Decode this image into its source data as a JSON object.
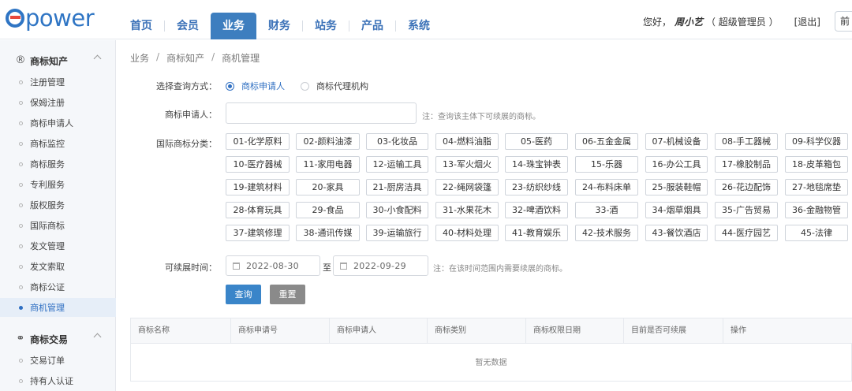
{
  "header": {
    "logo": "epower",
    "nav": [
      "首页",
      "会员",
      "业务",
      "财务",
      "站务",
      "产品",
      "系统"
    ],
    "active_nav": "业务",
    "greeting": "您好，",
    "username": "周小艺",
    "role": "（ 超级管理员 ）",
    "logout": "[退出]",
    "home_cut": "前"
  },
  "sidebar": {
    "group1": {
      "label": "商标知产",
      "icon": "registered-icon"
    },
    "items1": [
      "注册管理",
      "保姆注册",
      "商标申请人",
      "商标监控",
      "商标服务",
      "专利服务",
      "版权服务",
      "国际商标",
      "发文管理",
      "发文索取",
      "商标公证",
      "商机管理"
    ],
    "active_item": "商机管理",
    "group2": {
      "label": "商标交易",
      "icon": "handshake-icon"
    },
    "items2": [
      "交易订单",
      "持有人认证"
    ]
  },
  "breadcrumb": [
    "业务",
    "商标知产",
    "商机管理"
  ],
  "form": {
    "query_mode_label": "选择查询方式：",
    "query_options": [
      "商标申请人",
      "商标代理机构"
    ],
    "query_selected": "商标申请人",
    "applicant_label": "商标申请人：",
    "applicant_value": "",
    "applicant_note": "注：查询该主体下可续展的商标。",
    "category_label": "国际商标分类：",
    "categories": [
      "01-化学原料",
      "02-颜料油漆",
      "03-化妆品",
      "04-燃料油脂",
      "05-医药",
      "06-五金金属",
      "07-机械设备",
      "08-手工器械",
      "09-科学仪器",
      "10-医疗器械",
      "11-家用电器",
      "12-运输工具",
      "13-军火烟火",
      "14-珠宝钟表",
      "15-乐器",
      "16-办公工具",
      "17-橡胶制品",
      "18-皮革箱包",
      "19-建筑材料",
      "20-家具",
      "21-厨房洁具",
      "22-绳网袋篷",
      "23-纺织纱线",
      "24-布料床单",
      "25-服装鞋帽",
      "26-花边配饰",
      "27-地毯席垫",
      "28-体育玩具",
      "29-食品",
      "30-小食配料",
      "31-水果花木",
      "32-啤酒饮料",
      "33-酒",
      "34-烟草烟具",
      "35-广告贸易",
      "36-金融物管",
      "37-建筑修理",
      "38-通讯传媒",
      "39-运输旅行",
      "40-材料处理",
      "41-教育娱乐",
      "42-技术服务",
      "43-餐饮酒店",
      "44-医疗园艺",
      "45-法律"
    ],
    "renew_label": "可续展时间：",
    "date_from": "2022-08-30",
    "date_sep": "至",
    "date_to": "2022-09-29",
    "renew_note": "注：在该时间范围内需要续展的商标。",
    "query_button": "查询",
    "reset_button": "重置"
  },
  "table": {
    "columns": [
      "商标名称",
      "商标申请号",
      "商标申请人",
      "商标类别",
      "商标权限日期",
      "目前是否可续展",
      "操作"
    ],
    "empty_text": "暂无数据"
  },
  "colors": {
    "primary": "#3a85c9",
    "nav_active": "#3d7ebf",
    "logo_blue": "#2f75c4",
    "logo_red": "#e8483d"
  }
}
